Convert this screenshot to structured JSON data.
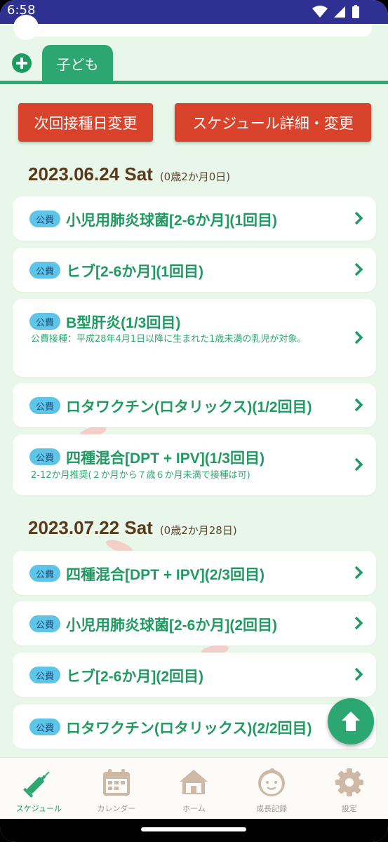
{
  "status_bar": {
    "time": "6:58"
  },
  "tabs": {
    "child_label": "子ども"
  },
  "actions": {
    "next_date_label": "次回接種日変更",
    "schedule_label": "スケジュール詳細・変更"
  },
  "groups": [
    {
      "date": "2023.06.24 Sat",
      "age": "(0歳2か月0日)",
      "items": [
        {
          "badge": "公費",
          "title": "小児用肺炎球菌[2-6か月](1回目)",
          "note": ""
        },
        {
          "badge": "公費",
          "title": "ヒブ[2-6か月](1回目)",
          "note": ""
        },
        {
          "badge": "公費",
          "title": "B型肝炎(1/3回目)",
          "note": "公費接種：平成28年4月1日以降に生まれた1歳未満の乳児が対象。"
        },
        {
          "badge": "公費",
          "title": "ロタワクチン(ロタリックス)(1/2回目)",
          "note": ""
        },
        {
          "badge": "公費",
          "title": "四種混合[DPT + IPV](1/3回目)",
          "note": "2-12か月推奨(２か月から７歳６か月未満で接種は可)"
        }
      ]
    },
    {
      "date": "2023.07.22 Sat",
      "age": "(0歳2か月28日)",
      "items": [
        {
          "badge": "公費",
          "title": "四種混合[DPT + IPV](2/3回目)",
          "note": ""
        },
        {
          "badge": "公費",
          "title": "小児用肺炎球菌[2-6か月](2回目)",
          "note": ""
        },
        {
          "badge": "公費",
          "title": "ヒブ[2-6か月](2回目)",
          "note": ""
        },
        {
          "badge": "公費",
          "title": "ロタワクチン(ロタリックス)(2/2回目)",
          "note": ""
        }
      ]
    }
  ],
  "bottom_nav": [
    {
      "label": "スケジュール",
      "icon": "syringe-icon",
      "active": true
    },
    {
      "label": "カレンダー",
      "icon": "calendar-icon",
      "active": false
    },
    {
      "label": "ホーム",
      "icon": "home-icon",
      "active": false
    },
    {
      "label": "成長記録",
      "icon": "baby-face-icon",
      "active": false
    },
    {
      "label": "設定",
      "icon": "gear-icon",
      "active": false
    }
  ],
  "colors": {
    "accent": "#2ca771",
    "action": "#d9432b",
    "badge": "#5ec5e8",
    "background": "#e9f7ea",
    "date": "#5a3a1a"
  }
}
